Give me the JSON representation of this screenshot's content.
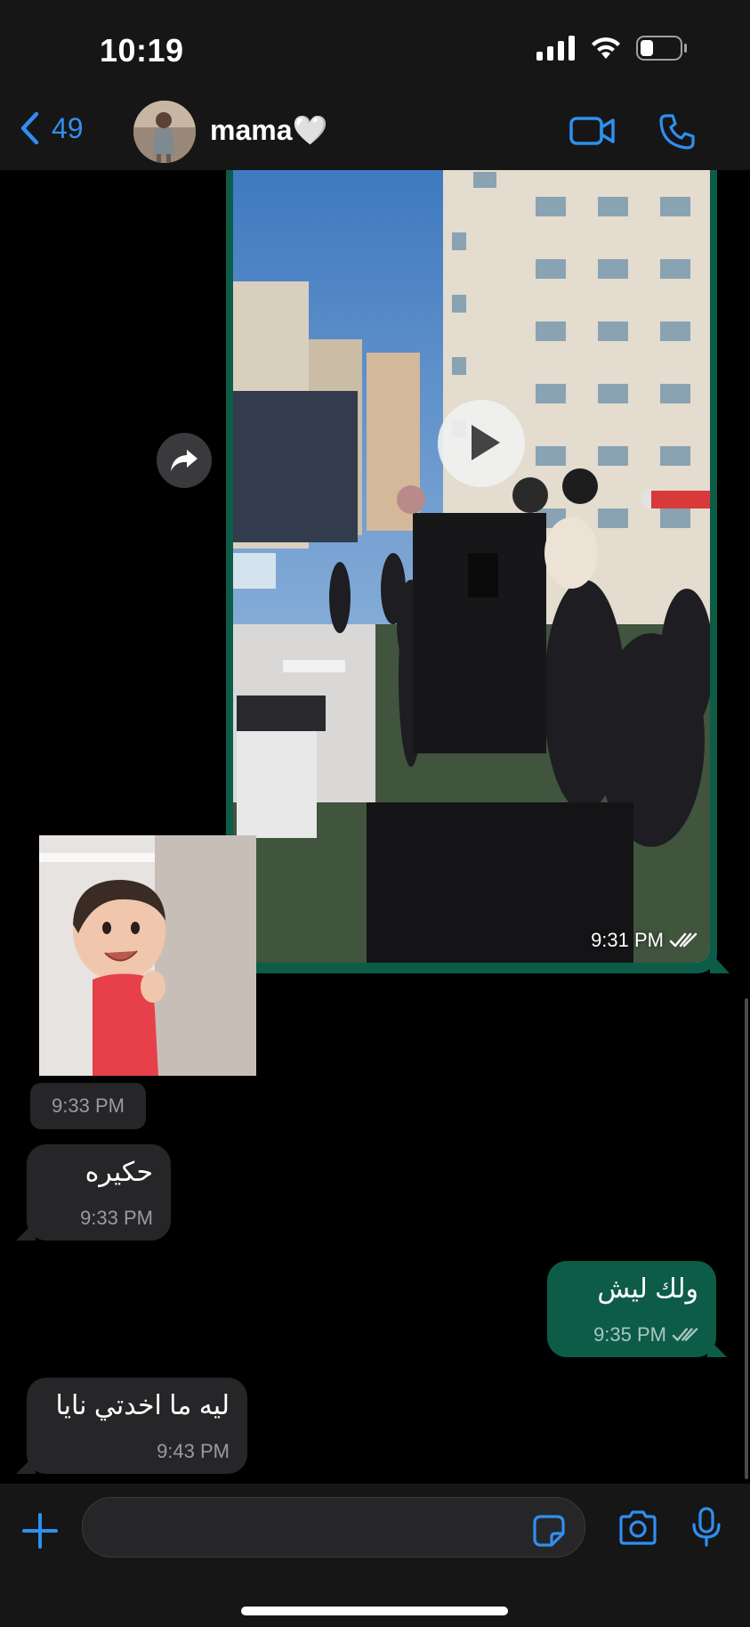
{
  "status_bar": {
    "time": "10:19"
  },
  "header": {
    "back_count": "49",
    "contact_name": "mama🤍"
  },
  "messages": {
    "video": {
      "time": "9:31 PM"
    },
    "photo": {
      "time": "9:33 PM"
    },
    "msg1": {
      "text": "حكيره",
      "time": "9:33 PM"
    },
    "msg2": {
      "text": "ولك ليش",
      "time": "9:35 PM"
    },
    "msg3": {
      "text": "ليه ما اخدتي نايا",
      "time": "9:43 PM"
    }
  },
  "input": {
    "placeholder": ""
  },
  "colors": {
    "accent": "#2f8ff0",
    "outgoing_bubble": "#0d5c48",
    "incoming_bubble": "#262628",
    "bar_background": "#161616"
  },
  "icons": [
    "signal-icon",
    "wifi-icon",
    "battery-icon",
    "back-chevron-icon",
    "video-call-icon",
    "phone-icon",
    "forward-icon",
    "play-icon",
    "double-check-icon",
    "plus-icon",
    "sticker-icon",
    "camera-icon",
    "microphone-icon"
  ]
}
